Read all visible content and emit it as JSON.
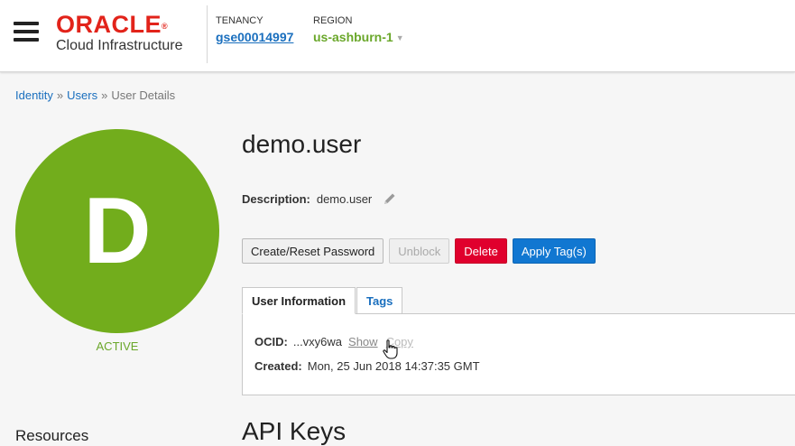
{
  "header": {
    "logo_word": "ORACLE",
    "logo_reg": "®",
    "logo_sub": "Cloud Infrastructure",
    "tenancy_label": "TENANCY",
    "tenancy_value": "gse00014997",
    "region_label": "REGION",
    "region_value": "us-ashburn-1"
  },
  "breadcrumb": {
    "items": [
      "Identity",
      "Users",
      "User Details"
    ],
    "separator": "»"
  },
  "user": {
    "avatar_letter": "D",
    "avatar_color": "#72ad1c",
    "status": "ACTIVE",
    "name": "demo.user",
    "description_label": "Description:",
    "description_value": "demo.user"
  },
  "actions": {
    "create_reset_password": "Create/Reset Password",
    "unblock": "Unblock",
    "delete": "Delete",
    "apply_tags": "Apply Tag(s)"
  },
  "tabs": {
    "user_information": "User Information",
    "tags": "Tags"
  },
  "user_info": {
    "ocid_label": "OCID:",
    "ocid_value": "...vxy6wa",
    "show_link": "Show",
    "copy_link": "Copy",
    "created_label": "Created:",
    "created_value": "Mon, 25 Jun 2018 14:37:35 GMT"
  },
  "resources_heading": "Resources",
  "api_keys_heading": "API Keys",
  "icons": {
    "menu": "hamburger-menu-icon",
    "edit": "pencil-icon",
    "cursor": "hand-pointer-icon"
  }
}
